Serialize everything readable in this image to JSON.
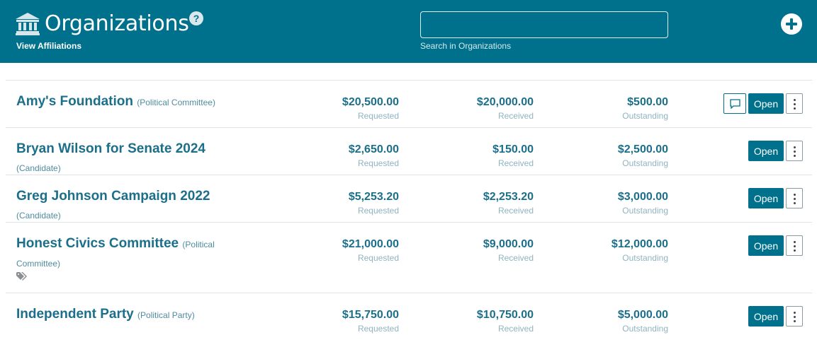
{
  "header": {
    "title": "Organizations",
    "help_icon": "?",
    "view_affiliations": "View Affiliations",
    "search_value": "",
    "search_label": "Search in Organizations",
    "colors": {
      "brand": "#00718c",
      "text_on_brand": "#ffffff"
    }
  },
  "organizations": [
    {
      "name": "Amy's Foundation",
      "type": "(Political Committee)",
      "requested": "$20,500.00",
      "requested_label": "Requested",
      "received": "$20,000.00",
      "received_label": "Received",
      "outstanding": "$500.00",
      "outstanding_label": "Outstanding",
      "open_label": "Open",
      "has_note": true,
      "has_tag": false
    },
    {
      "name": "Bryan Wilson for Senate 2024",
      "type": "(Candidate)",
      "requested": "$2,650.00",
      "requested_label": "Requested",
      "received": "$150.00",
      "received_label": "Received",
      "outstanding": "$2,500.00",
      "outstanding_label": "Outstanding",
      "open_label": "Open",
      "has_note": false,
      "has_tag": false
    },
    {
      "name": "Greg Johnson Campaign 2022",
      "type": "(Candidate)",
      "requested": "$5,253.20",
      "requested_label": "Requested",
      "received": "$2,253.20",
      "received_label": "Received",
      "outstanding": "$3,000.00",
      "outstanding_label": "Outstanding",
      "open_label": "Open",
      "has_note": false,
      "has_tag": false
    },
    {
      "name": "Honest Civics Committee",
      "type": "(Political Committee)",
      "requested": "$21,000.00",
      "requested_label": "Requested",
      "received": "$9,000.00",
      "received_label": "Received",
      "outstanding": "$12,000.00",
      "outstanding_label": "Outstanding",
      "open_label": "Open",
      "has_note": false,
      "has_tag": true
    },
    {
      "name": "Independent Party",
      "type": "(Political Party)",
      "requested": "$15,750.00",
      "requested_label": "Requested",
      "received": "$10,750.00",
      "received_label": "Received",
      "outstanding": "$5,000.00",
      "outstanding_label": "Outstanding",
      "open_label": "Open",
      "has_note": false,
      "has_tag": false
    }
  ]
}
